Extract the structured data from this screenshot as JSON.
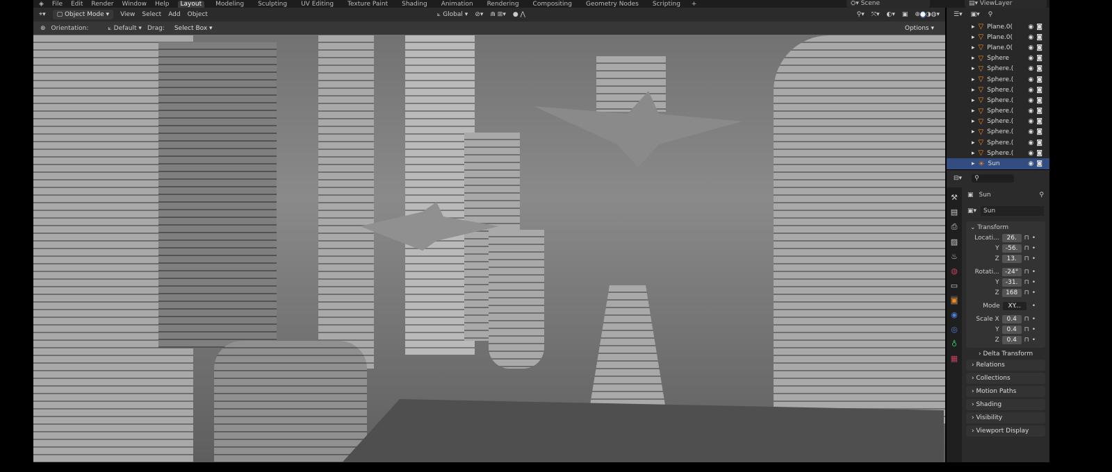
{
  "menu": [
    "File",
    "Edit",
    "Render",
    "Window",
    "Help"
  ],
  "workspaces": [
    "Layout",
    "Modeling",
    "Sculpting",
    "UV Editing",
    "Texture Paint",
    "Shading",
    "Animation",
    "Rendering",
    "Compositing",
    "Geometry Nodes",
    "Scripting",
    "+"
  ],
  "scene": "Scene",
  "view_layer": "ViewLayer",
  "header": {
    "mode": "Object Mode",
    "view": "View",
    "select": "Select",
    "add": "Add",
    "object": "Object",
    "transform": "Global"
  },
  "toolhdr": {
    "orientation_label": "Orientation:",
    "orientation": "Default",
    "drag_label": "Drag:",
    "drag": "Select Box",
    "options": "Options"
  },
  "outliner": {
    "items": [
      "Plane.0(",
      "Plane.0(",
      "Plane.0(",
      "Sphere",
      "Sphere.(",
      "Sphere.(",
      "Sphere.(",
      "Sphere.(",
      "Sphere.(",
      "Sphere.(",
      "Sphere.(",
      "Sphere.(",
      "Sphere.(",
      "Sun"
    ]
  },
  "props": {
    "object_name": "Sun",
    "data_name": "Sun",
    "transform": "Transform",
    "location_label": "Locati...",
    "location": [
      "26.",
      "-56.",
      "13."
    ],
    "rotation_label": "Rotati...",
    "rotation": [
      "-24°",
      "-31.",
      "168"
    ],
    "mode_label": "Mode",
    "mode": "XY...",
    "scale_label": "Scale X",
    "scale": [
      "0.4",
      "0.4",
      "0.4"
    ],
    "y": "Y",
    "z": "Z",
    "delta": "Delta Transform",
    "panels": [
      "Relations",
      "Collections",
      "Motion Paths",
      "Shading",
      "Visibility",
      "Viewport Display"
    ]
  },
  "colors": {
    "selected": "#334d80",
    "accent": "#4772b3",
    "object_orange": "#f08a24"
  }
}
